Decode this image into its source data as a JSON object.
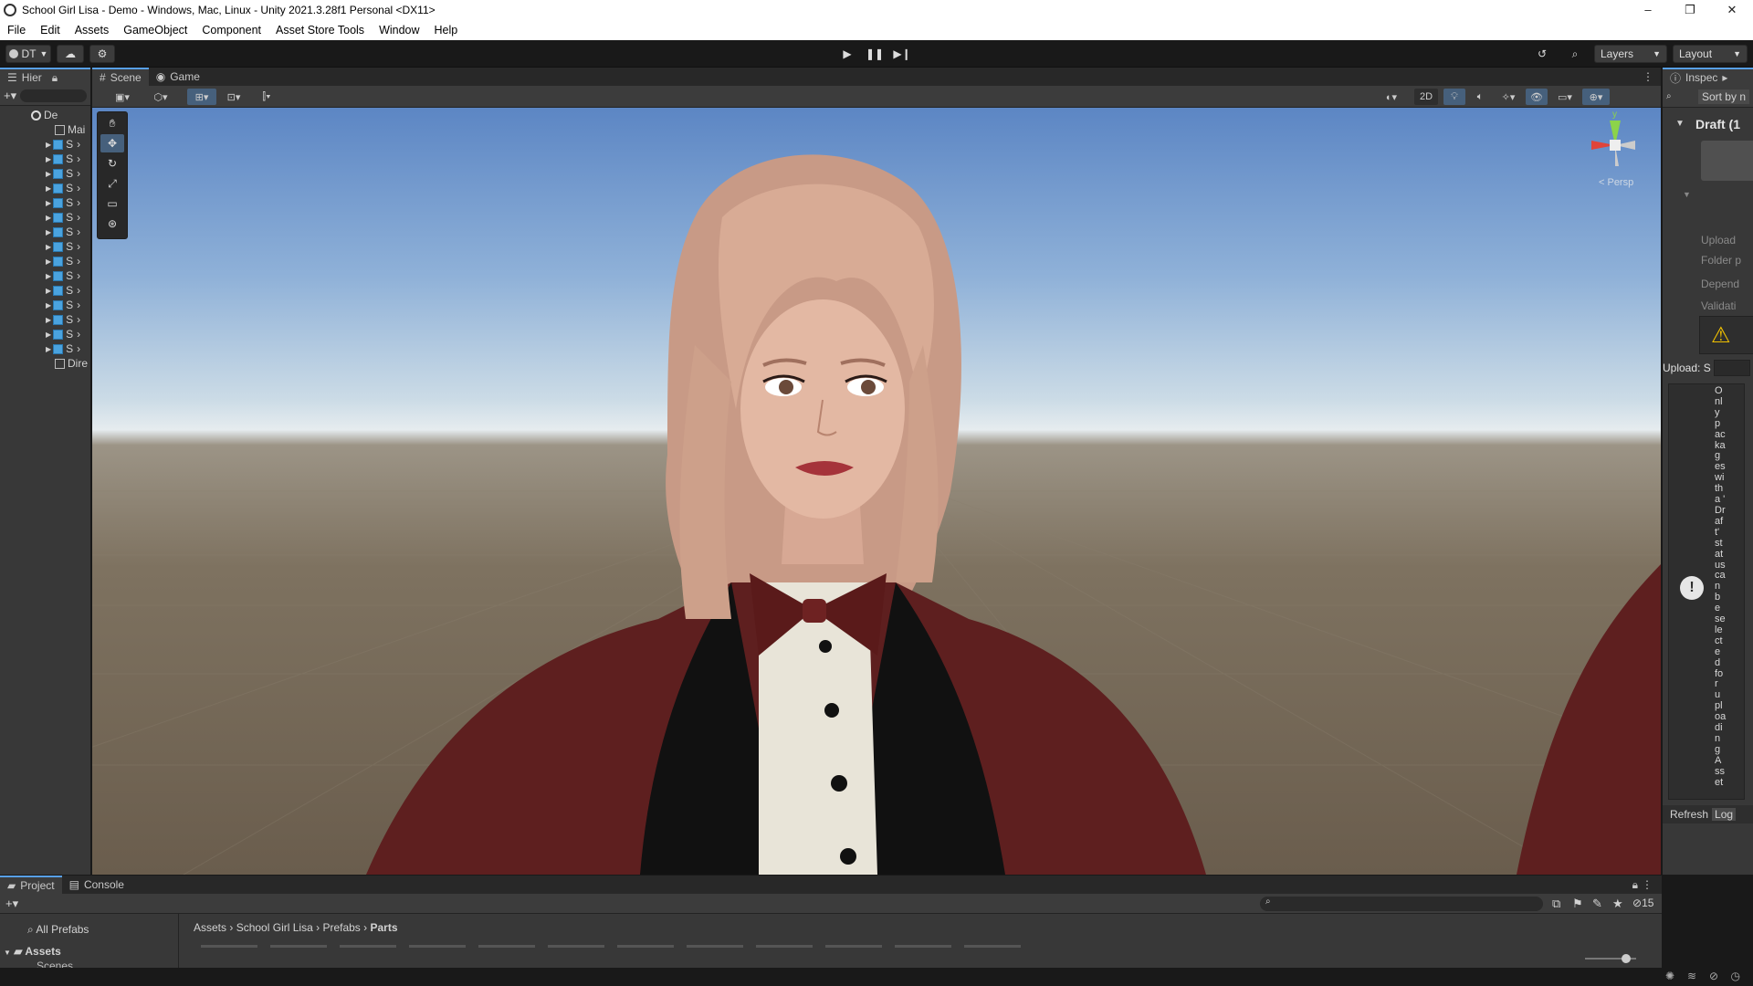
{
  "window": {
    "title": "School Girl Lisa - Demo - Windows, Mac, Linux - Unity 2021.3.28f1 Personal <DX11>",
    "minimize": "–",
    "maximize": "❐",
    "close": "✕"
  },
  "menu": [
    "File",
    "Edit",
    "Assets",
    "GameObject",
    "Component",
    "Asset Store Tools",
    "Window",
    "Help"
  ],
  "toolbar": {
    "account": "DT",
    "layers": "Layers",
    "layout": "Layout"
  },
  "hierarchy": {
    "tab": "Hier",
    "root": "De",
    "main_item": "Mai",
    "item_label": "S",
    "last_item": "Dire"
  },
  "scene": {
    "tabs": [
      "Scene",
      "Game"
    ],
    "toggle_2d": "2D",
    "persp": "< Persp",
    "gizmo_y": "y"
  },
  "inspector": {
    "tab": "Inspec",
    "sort": "Sort by n",
    "title": "Draft (1",
    "rows": [
      "Upload",
      "Folder p",
      "Depend",
      "Validati"
    ],
    "upload_label": "Upload: S",
    "vertical_text": [
      "O",
      "nl",
      "y",
      "p",
      "ac",
      "ka",
      "g",
      "es",
      "wi",
      "th",
      "a '",
      "Dr",
      "af",
      "t'",
      "st",
      "at",
      "us",
      "ca",
      "n",
      "b",
      "e",
      "se",
      "le",
      "ct",
      "e",
      "d",
      "fo",
      "r",
      "u",
      "pl",
      "oa",
      "di",
      "n",
      "g",
      "A",
      "ss",
      "et"
    ],
    "refresh": "Refresh",
    "log": "Log"
  },
  "project": {
    "tabs": [
      "Project",
      "Console"
    ],
    "all_prefabs": "All Prefabs",
    "assets": "Assets",
    "scenes": "Scenes",
    "breadcrumb": [
      "Assets",
      "School Girl Lisa",
      "Prefabs",
      "Parts"
    ],
    "hidden_count": "15"
  },
  "colors": {
    "accent": "#58a0e6",
    "selection": "#2c5d87",
    "panel_bg": "#383838",
    "chrome_bg": "#191919"
  }
}
